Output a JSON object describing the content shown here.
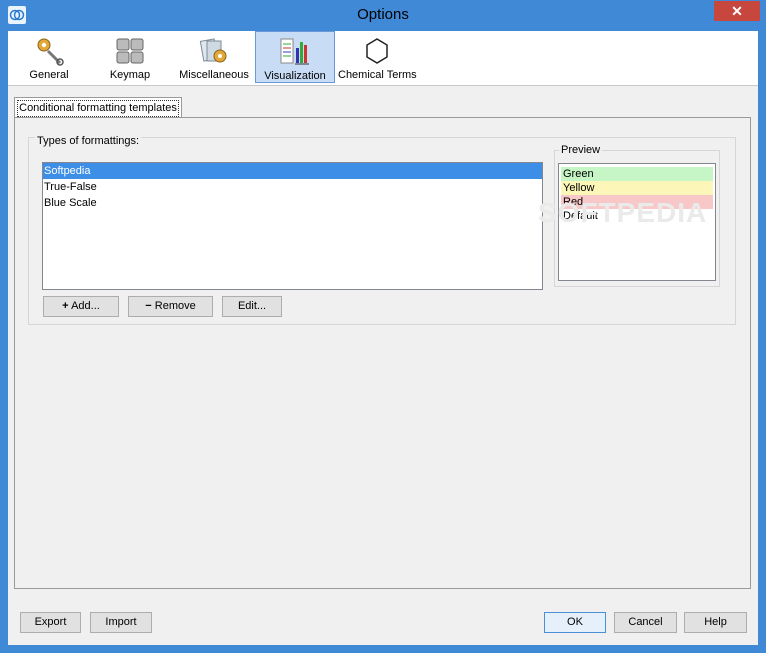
{
  "window": {
    "title": "Options",
    "close_label": "✕"
  },
  "toolbar": {
    "items": [
      {
        "label": "General",
        "icon": "gear-wrench-icon"
      },
      {
        "label": "Keymap",
        "icon": "keyboard-icon"
      },
      {
        "label": "Miscellaneous",
        "icon": "cards-gear-icon"
      },
      {
        "label": "Visualization",
        "icon": "visualization-chart-icon",
        "selected": true
      },
      {
        "label": "Chemical Terms",
        "icon": "benzene-ring-icon"
      }
    ]
  },
  "tab": {
    "label": "Conditional formatting templates"
  },
  "formattings": {
    "label": "Types of formattings:",
    "items": [
      "Softpedia",
      "True-False",
      "Blue Scale"
    ],
    "selected": "Softpedia"
  },
  "preview": {
    "label": "Preview",
    "items": [
      {
        "label": "Green",
        "color": "#c6f5c6"
      },
      {
        "label": "Yellow",
        "color": "#fcf7b8"
      },
      {
        "label": "Red",
        "color": "#f8c8c8"
      },
      {
        "label": "Default",
        "color": "#ffffff"
      }
    ]
  },
  "list_buttons": {
    "add": "Add...",
    "remove": "Remove",
    "edit": "Edit..."
  },
  "bottom_buttons": {
    "export": "Export",
    "import": "Import",
    "ok": "OK",
    "cancel": "Cancel",
    "help": "Help"
  },
  "watermark": "SOFTPEDIA"
}
